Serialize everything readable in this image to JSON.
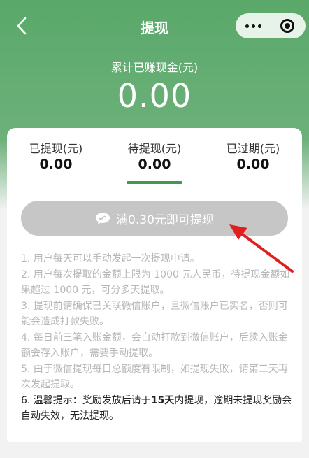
{
  "header": {
    "title": "提现",
    "back_icon": "chevron-left-icon"
  },
  "summary": {
    "label": "累计已赚现金(元)",
    "value": "0.00"
  },
  "tabs": [
    {
      "label": "已提现(元)",
      "value": "0.00",
      "active": false
    },
    {
      "label": "待提现(元)",
      "value": "0.00",
      "active": true
    },
    {
      "label": "已过期(元)",
      "value": "0.00",
      "active": false
    }
  ],
  "withdraw_button": {
    "label": "满0.30元即可提现",
    "icon": "wechat-icon"
  },
  "rules": [
    "1. 用户每天可以手动发起一次提现申请。",
    "2. 用户每次提取的金额上限为 1000 元人民币，待提现金额如果超过 1000 元，可分多天提取。",
    "3. 提现前请确保已关联微信账户，且微信账户已实名，否则可能会造成打款失败。",
    "4. 每日前三笔入账金额，会自动打款到微信账户，后续入账金额会存入账户，需要手动提取。",
    "5. 由于微信提现每日总额度有限制，如提现失败，请第二天再次发起提取。"
  ],
  "warning": {
    "prefix": "6. 温馨提示：奖励发放后请于",
    "highlight": "15天",
    "suffix": "内提现，逾期未提现奖励会自动失效，无法提现。"
  },
  "colors": {
    "brand_green": "#5aa86a",
    "tab_indicator": "#3d9a4f",
    "button_disabled": "#c6c6c6",
    "annotation_arrow": "#e02020"
  }
}
